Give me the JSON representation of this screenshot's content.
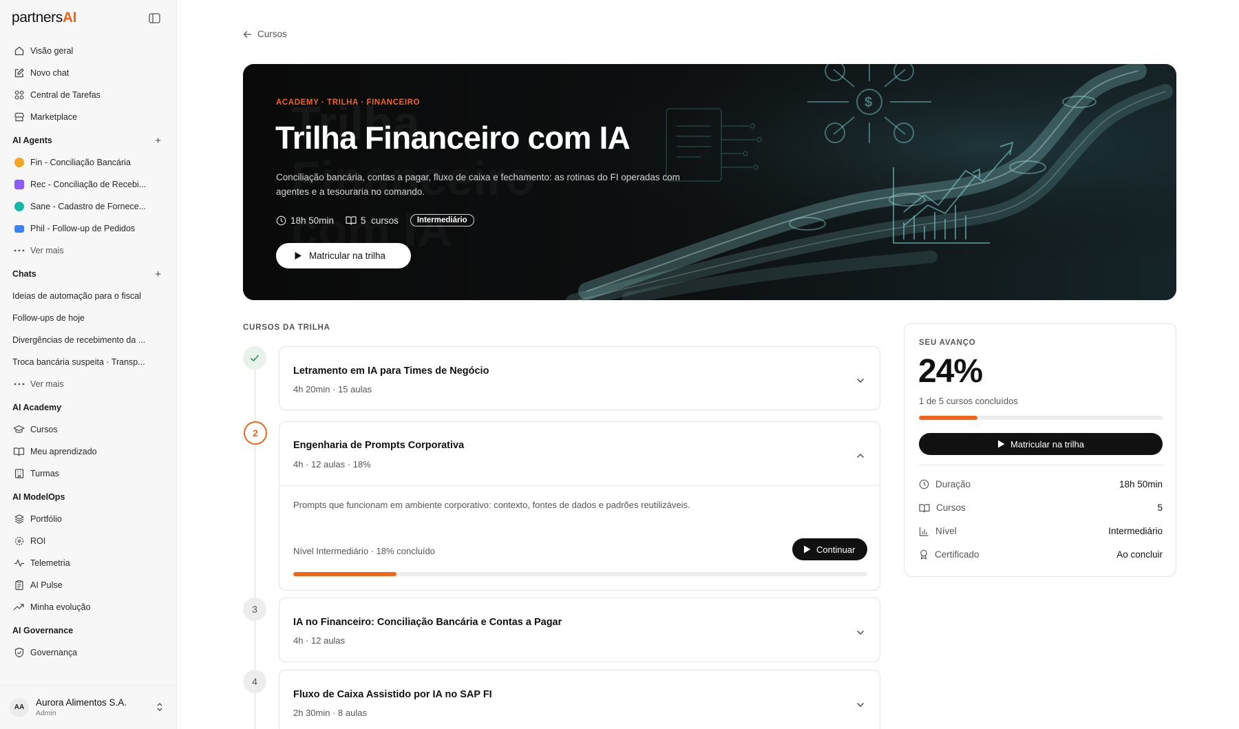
{
  "brand": {
    "part1": "partners",
    "part2": "AI"
  },
  "sidebar": {
    "main": [
      {
        "label": "Visão geral",
        "icon": "home-icon"
      },
      {
        "label": "Novo chat",
        "icon": "edit-icon"
      },
      {
        "label": "Central de Tarefas",
        "icon": "grid-icon"
      },
      {
        "label": "Marketplace",
        "icon": "store-icon"
      }
    ],
    "agents_title": "AI Agents",
    "agents": [
      {
        "label": "Fin - Conciliação Bancária",
        "color": "#f5a524"
      },
      {
        "label": "Rec - Conciliação de Recebi...",
        "color": "#8b5cf6"
      },
      {
        "label": "Sane - Cadastro de Fornece...",
        "color": "#14b8a6"
      },
      {
        "label": "Phil - Follow-up de Pedidos",
        "color": "#3b82f6"
      }
    ],
    "agents_more": "Ver mais",
    "chats_title": "Chats",
    "chats": [
      "Ideias de automação para o fiscal",
      "Follow-ups de hoje",
      "Divergências de recebimento da ...",
      "Troca bancária suspeita · Transp..."
    ],
    "chats_more": "Ver mais",
    "academy_title": "AI Academy",
    "academy": [
      "Cursos",
      "Meu aprendizado",
      "Turmas"
    ],
    "modelops_title": "AI ModelOps",
    "modelops": [
      "Portfólio",
      "ROI",
      "Telemetria",
      "AI Pulse",
      "Minha evolução"
    ],
    "governance_title": "AI Governance",
    "governance": [
      "Governança"
    ],
    "org": {
      "initials": "AA",
      "name": "Aurora Alimentos S.A.",
      "role": "Admin"
    }
  },
  "back_label": "Cursos",
  "hero": {
    "eyebrow": "ACADEMY · TRILHA · FINANCEIRO",
    "title": "Trilha Financeiro com IA",
    "description": "Conciliação bancária, contas a pagar, fluxo de caixa e fechamento: as rotinas do FI operadas com agentes e a tesouraria no comando.",
    "duration": "18h 50min",
    "courses_count": "5",
    "courses_word": "cursos",
    "level": "Intermediário",
    "cta": "Matricular na trilha"
  },
  "list_title": "CURSOS DA TRILHA",
  "courses": [
    {
      "step": "",
      "title": "Letramento em IA para Times de Negócio",
      "sub": "4h 20min · 15 aulas",
      "state": "done"
    },
    {
      "step": "2",
      "title": "Engenharia de Prompts Corporativa",
      "sub": "4h · 12 aulas · 18%",
      "state": "active",
      "body": "Prompts que funcionam em ambiente corporativo: contexto, fontes de dados e padrões reutilizáveis.",
      "level": "Nível Intermediário · 18% concluído",
      "progress": 0.18,
      "cta": "Continuar"
    },
    {
      "step": "3",
      "title": "IA no Financeiro: Conciliação Bancária e Contas a Pagar",
      "sub": "4h · 12 aulas",
      "state": "todo"
    },
    {
      "step": "4",
      "title": "Fluxo de Caixa Assistido por IA no SAP FI",
      "sub": "2h 30min · 8 aulas",
      "state": "todo"
    }
  ],
  "panel": {
    "title": "SEU AVANÇO",
    "percent": "24%",
    "progress": 0.24,
    "done_text": "1 de 5 cursos concluídos",
    "cta": "Matricular na trilha",
    "rows": [
      {
        "key": "Duração",
        "value": "18h 50min",
        "icon": "clock-icon"
      },
      {
        "key": "Cursos",
        "value": "5",
        "icon": "book-icon"
      },
      {
        "key": "Nível",
        "value": "Intermediário",
        "icon": "bar-chart-icon"
      },
      {
        "key": "Certificado",
        "value": "Ao concluir",
        "icon": "award-icon"
      }
    ]
  },
  "colors": {
    "accent": "#f26419",
    "dark": "#111111",
    "done_bg": "#e7f3ea",
    "done_check": "#2e8b57"
  }
}
